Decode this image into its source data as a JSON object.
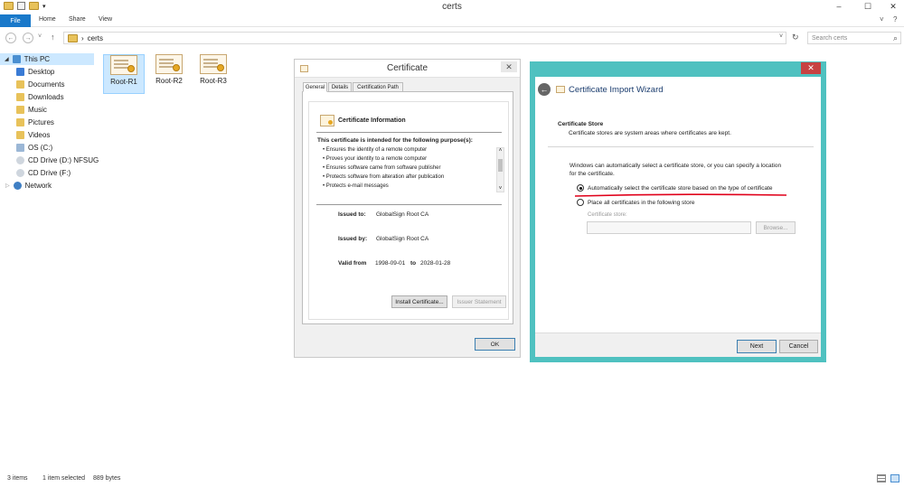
{
  "window": {
    "title": "certs",
    "minimize": "–",
    "maximize": "☐",
    "close": "✕"
  },
  "ribbon": {
    "file": "File",
    "tabs": [
      "Home",
      "Share",
      "View"
    ],
    "collapse": "˅",
    "help": "?"
  },
  "address": {
    "back": "←",
    "forward": "→",
    "recent": "˅",
    "up": "↑",
    "crumb_sep": "›",
    "path": "certs",
    "dropdown": "˅",
    "refresh": "↻",
    "search_placeholder": "Search certs",
    "search_icon": "⌕"
  },
  "nav": {
    "items": [
      {
        "label": "This PC",
        "icon": "computer-icon"
      },
      {
        "label": "Desktop",
        "icon": "desktop-folder-icon"
      },
      {
        "label": "Documents",
        "icon": "documents-folder-icon"
      },
      {
        "label": "Downloads",
        "icon": "downloads-folder-icon"
      },
      {
        "label": "Music",
        "icon": "music-folder-icon"
      },
      {
        "label": "Pictures",
        "icon": "pictures-folder-icon"
      },
      {
        "label": "Videos",
        "icon": "videos-folder-icon"
      },
      {
        "label": "OS (C:)",
        "icon": "drive-icon"
      },
      {
        "label": "CD Drive (D:) NFSUG",
        "icon": "cd-drive-icon"
      },
      {
        "label": "CD Drive (F:)",
        "icon": "cd-drive-icon"
      },
      {
        "label": "Network",
        "icon": "network-icon"
      }
    ]
  },
  "files": [
    {
      "name": "Root-R1",
      "selected": true
    },
    {
      "name": "Root-R2",
      "selected": false
    },
    {
      "name": "Root-R3",
      "selected": false
    }
  ],
  "cert_dialog": {
    "title": "Certificate",
    "close": "✕",
    "tabs": [
      "General",
      "Details",
      "Certification Path"
    ],
    "info_heading": "Certificate Information",
    "purpose_heading": "This certificate is intended for the following purpose(s):",
    "purposes": [
      "Ensures the identity of a remote computer",
      "Proves your identity to a remote computer",
      "Ensures software came from software publisher",
      "Protects software from alteration after publication",
      "Protects e-mail messages"
    ],
    "scroll_up": "˄",
    "scroll_down": "˅",
    "issued_to_label": "Issued to:",
    "issued_to": "GlobalSign Root CA",
    "issued_by_label": "Issued by:",
    "issued_by": "GlobalSign Root CA",
    "valid_from_label": "Valid from",
    "valid_from": "1998-09-01",
    "valid_to_label": "to",
    "valid_to": "2028-01-28",
    "install_button": "Install Certificate...",
    "issuer_button": "Issuer Statement",
    "ok_button": "OK"
  },
  "wizard": {
    "title": "Certificate Import Wizard",
    "close": "✕",
    "back": "←",
    "section_title": "Certificate Store",
    "section_desc": "Certificate stores are system areas where certificates are kept.",
    "instruction_line1": "Windows can automatically select a certificate store, or you can specify a location",
    "instruction_line2": "for the certificate.",
    "radio_auto": "Automatically select the certificate store based on the type of certificate",
    "radio_manual": "Place all certificates in the following store",
    "store_label": "Certificate store:",
    "store_value": "",
    "browse_button": "Browse...",
    "next_button": "Next",
    "cancel_button": "Cancel",
    "highlight_color": "#e0001a"
  },
  "status": {
    "items": "3 items",
    "selected": "1 item selected",
    "size": "889 bytes"
  }
}
